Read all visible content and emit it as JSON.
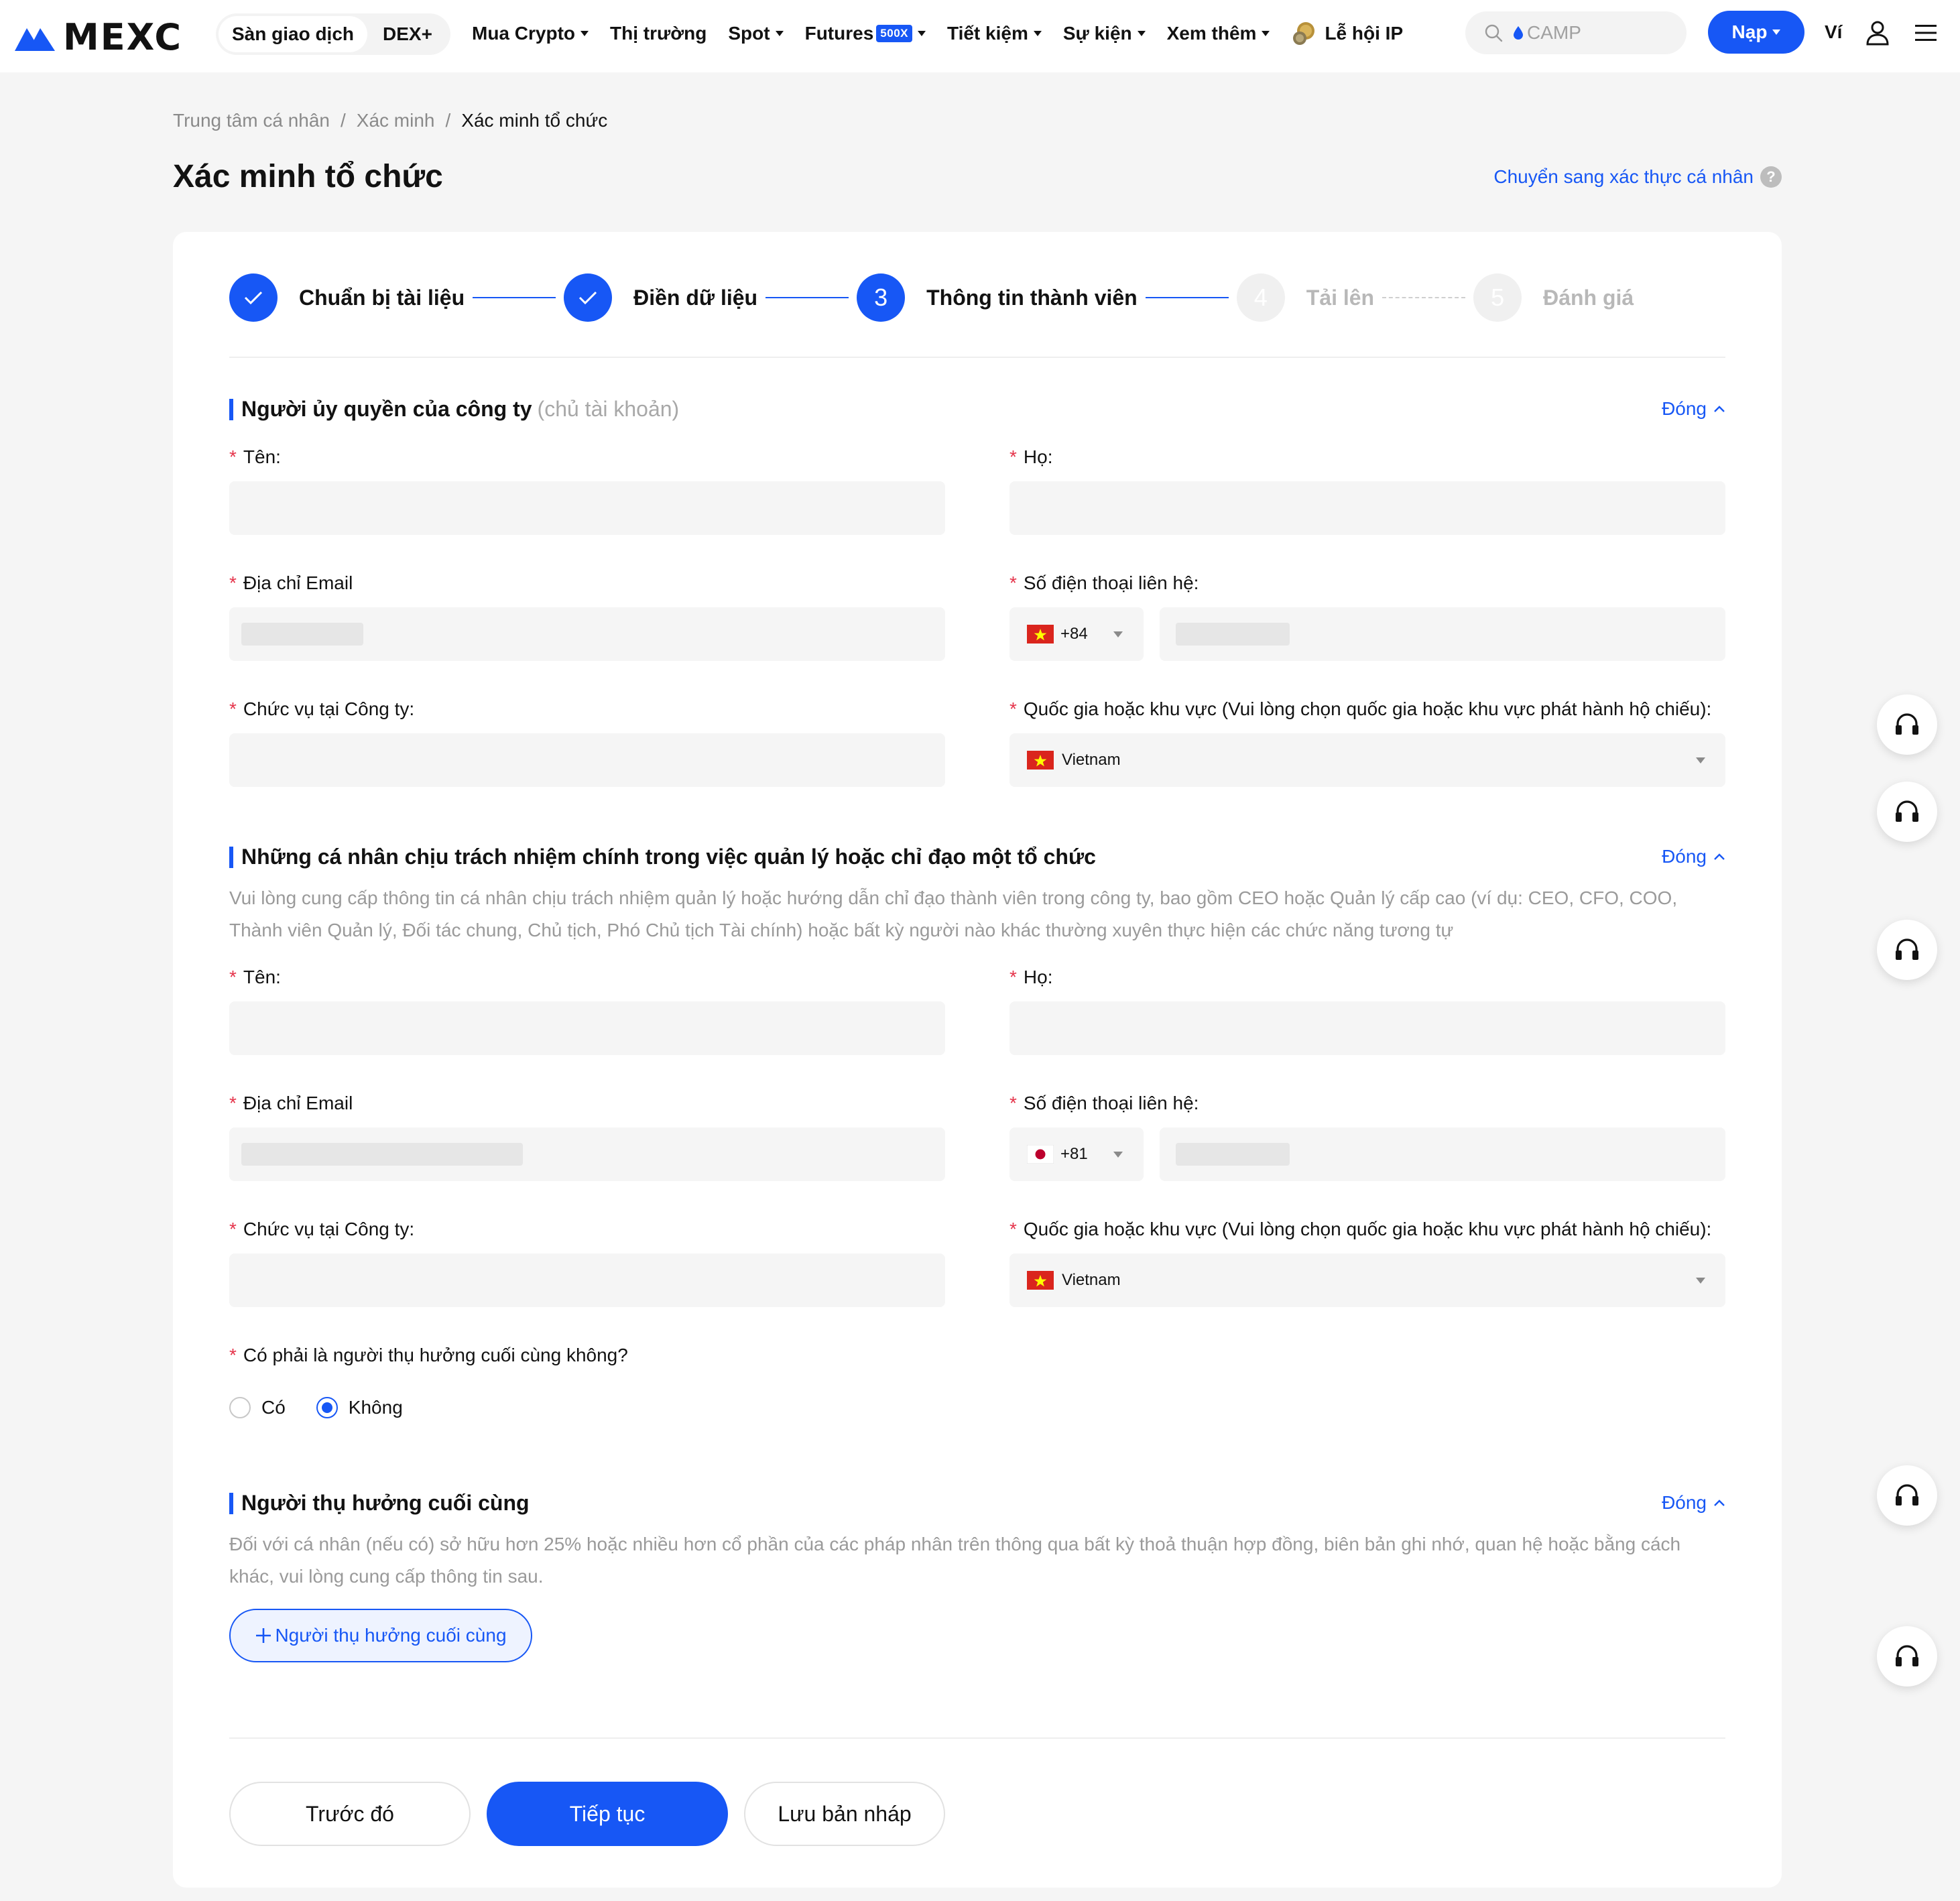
{
  "header": {
    "logo_text": "MEXC",
    "modes": [
      "Sàn giao dịch",
      "DEX+"
    ],
    "nav": [
      {
        "label": "Mua Crypto",
        "caret": true
      },
      {
        "label": "Thị trường",
        "caret": false
      },
      {
        "label": "Spot",
        "caret": true
      },
      {
        "label": "Futures",
        "caret": true,
        "badge": "500X"
      },
      {
        "label": "Tiết kiệm",
        "caret": true
      },
      {
        "label": "Sự kiện",
        "caret": true
      },
      {
        "label": "Xem thêm",
        "caret": true
      },
      {
        "label": "Lễ hội IP",
        "caret": false,
        "icon": "coin-icon"
      }
    ],
    "search_placeholder": "CAMP",
    "deposit_label": "Nạp",
    "wallet_label": "Ví",
    "accent": "#1757f5"
  },
  "breadcrumb": [
    "Trung tâm cá nhân",
    "Xác minh",
    "Xác minh tổ chức"
  ],
  "page_title": "Xác minh tổ chức",
  "switch_link": "Chuyển sang xác thực cá nhân",
  "help_glyph": "?",
  "steps": [
    {
      "index": "1",
      "label": "Chuẩn bị tài liệu",
      "status": "done"
    },
    {
      "index": "2",
      "label": "Điền dữ liệu",
      "status": "done"
    },
    {
      "index": "3",
      "label": "Thông tin thành viên",
      "status": "current"
    },
    {
      "index": "4",
      "label": "Tải lên",
      "status": "pending"
    },
    {
      "index": "5",
      "label": "Đánh giá",
      "status": "pending"
    }
  ],
  "collapse_label": "Đóng",
  "required_mark": "*",
  "section1": {
    "title": "Người ủy quyền của công ty",
    "title_muted": "(chủ tài khoản)",
    "labels": {
      "first_name": "Tên:",
      "last_name": "Họ:",
      "email": "Địa chỉ Email",
      "phone": "Số điện thoại liên hệ:",
      "position": "Chức vụ tại Công ty:",
      "country": "Quốc gia hoặc khu vực (Vui lòng chọn quốc gia hoặc khu vực phát hành hộ chiếu):"
    },
    "phone_code": "+84",
    "country_value": "Vietnam"
  },
  "section2": {
    "title": "Những cá nhân chịu trách nhiệm chính trong việc quản lý hoặc chỉ đạo một tổ chức",
    "description": "Vui lòng cung cấp thông tin cá nhân chịu trách nhiệm quản lý hoặc hướng dẫn chỉ đạo thành viên trong công ty, bao gồm CEO hoặc Quản lý cấp cao (ví dụ: CEO, CFO, COO, Thành viên Quản lý, Đối tác chung, Chủ tịch, Phó Chủ tịch Tài chính) hoặc bất kỳ người nào khác thường xuyên thực hiện các chức năng tương tự",
    "labels": {
      "first_name": "Tên:",
      "last_name": "Họ:",
      "email": "Địa chỉ Email",
      "phone": "Số điện thoại liên hệ:",
      "position": "Chức vụ tại Công ty:",
      "country": "Quốc gia hoặc khu vực (Vui lòng chọn quốc gia hoặc khu vực phát hành hộ chiếu):"
    },
    "phone_code": "+81",
    "country_value": "Vietnam",
    "ubo_question": "Có phải là người thụ hưởng cuối cùng không?",
    "options": [
      "Có",
      "Không"
    ],
    "selected": "Không"
  },
  "section3": {
    "title": "Người thụ hưởng cuối cùng",
    "description": "Đối với cá nhân (nếu có) sở hữu hơn 25% hoặc nhiều hơn cổ phần của các pháp nhân trên thông qua bất kỳ thoả thuận hợp đồng, biên bản ghi nhớ, quan hệ hoặc bằng cách khác, vui lòng cung cấp thông tin sau.",
    "add_label": "Người thụ hưởng cuối cùng"
  },
  "footer": {
    "prev": "Trước đó",
    "next": "Tiếp tục",
    "draft": "Lưu bản nháp"
  },
  "support_icons": [
    "headset-icon",
    "headset-icon",
    "headset-icon",
    "headset-icon",
    "headset-icon"
  ]
}
